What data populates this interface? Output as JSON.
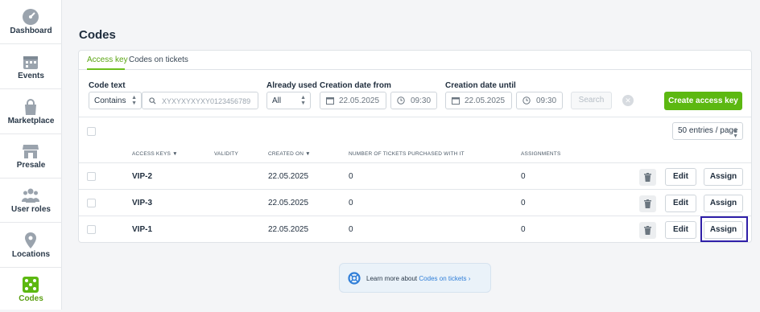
{
  "sidebar": {
    "items": [
      {
        "label": "Dashboard",
        "icon": "gauge-icon"
      },
      {
        "label": "Events",
        "icon": "calendar-icon"
      },
      {
        "label": "Marketplace",
        "icon": "bag-icon"
      },
      {
        "label": "Presale",
        "icon": "store-icon"
      },
      {
        "label": "User roles",
        "icon": "users-icon"
      },
      {
        "label": "Locations",
        "icon": "map-pin-icon"
      },
      {
        "label": "Codes",
        "icon": "dice-icon",
        "active": true
      }
    ]
  },
  "page": {
    "title": "Codes"
  },
  "tabs": [
    {
      "label": "Access key",
      "active": true
    },
    {
      "label": "Codes on tickets"
    }
  ],
  "filters": {
    "code_text_label": "Code text",
    "code_text_mode": "Contains",
    "code_text_placeholder": "XYXYXYXYXY0123456789",
    "already_used_label": "Already used",
    "already_used_value": "All",
    "date_from_label": "Creation date from",
    "date_from": "22.05.2025",
    "time_from": "09:30",
    "date_until_label": "Creation date until",
    "date_until": "22.05.2025",
    "time_until": "09:30",
    "search_label": "Search",
    "create_label": "Create access key"
  },
  "table": {
    "page_size": "50 entries / page",
    "columns": [
      "ACCESS KEYS",
      "VALIDITY",
      "CREATED ON",
      "NUMBER OF TICKETS PURCHASED WITH IT",
      "ASSIGNMENTS"
    ],
    "rows": [
      {
        "key": "VIP-2",
        "validity": "",
        "created": "22.05.2025",
        "tickets": "0",
        "assignments": "0"
      },
      {
        "key": "VIP-3",
        "validity": "",
        "created": "22.05.2025",
        "tickets": "0",
        "assignments": "0"
      },
      {
        "key": "VIP-1",
        "validity": "",
        "created": "22.05.2025",
        "tickets": "0",
        "assignments": "0"
      }
    ],
    "edit_label": "Edit",
    "assign_label": "Assign"
  },
  "help": {
    "prefix": "Learn more about",
    "link": "Codes on tickets",
    "chevron": "›"
  },
  "colors": {
    "accent": "#5cb811",
    "focus": "#2f1fa8",
    "link": "#2f7ed8"
  }
}
